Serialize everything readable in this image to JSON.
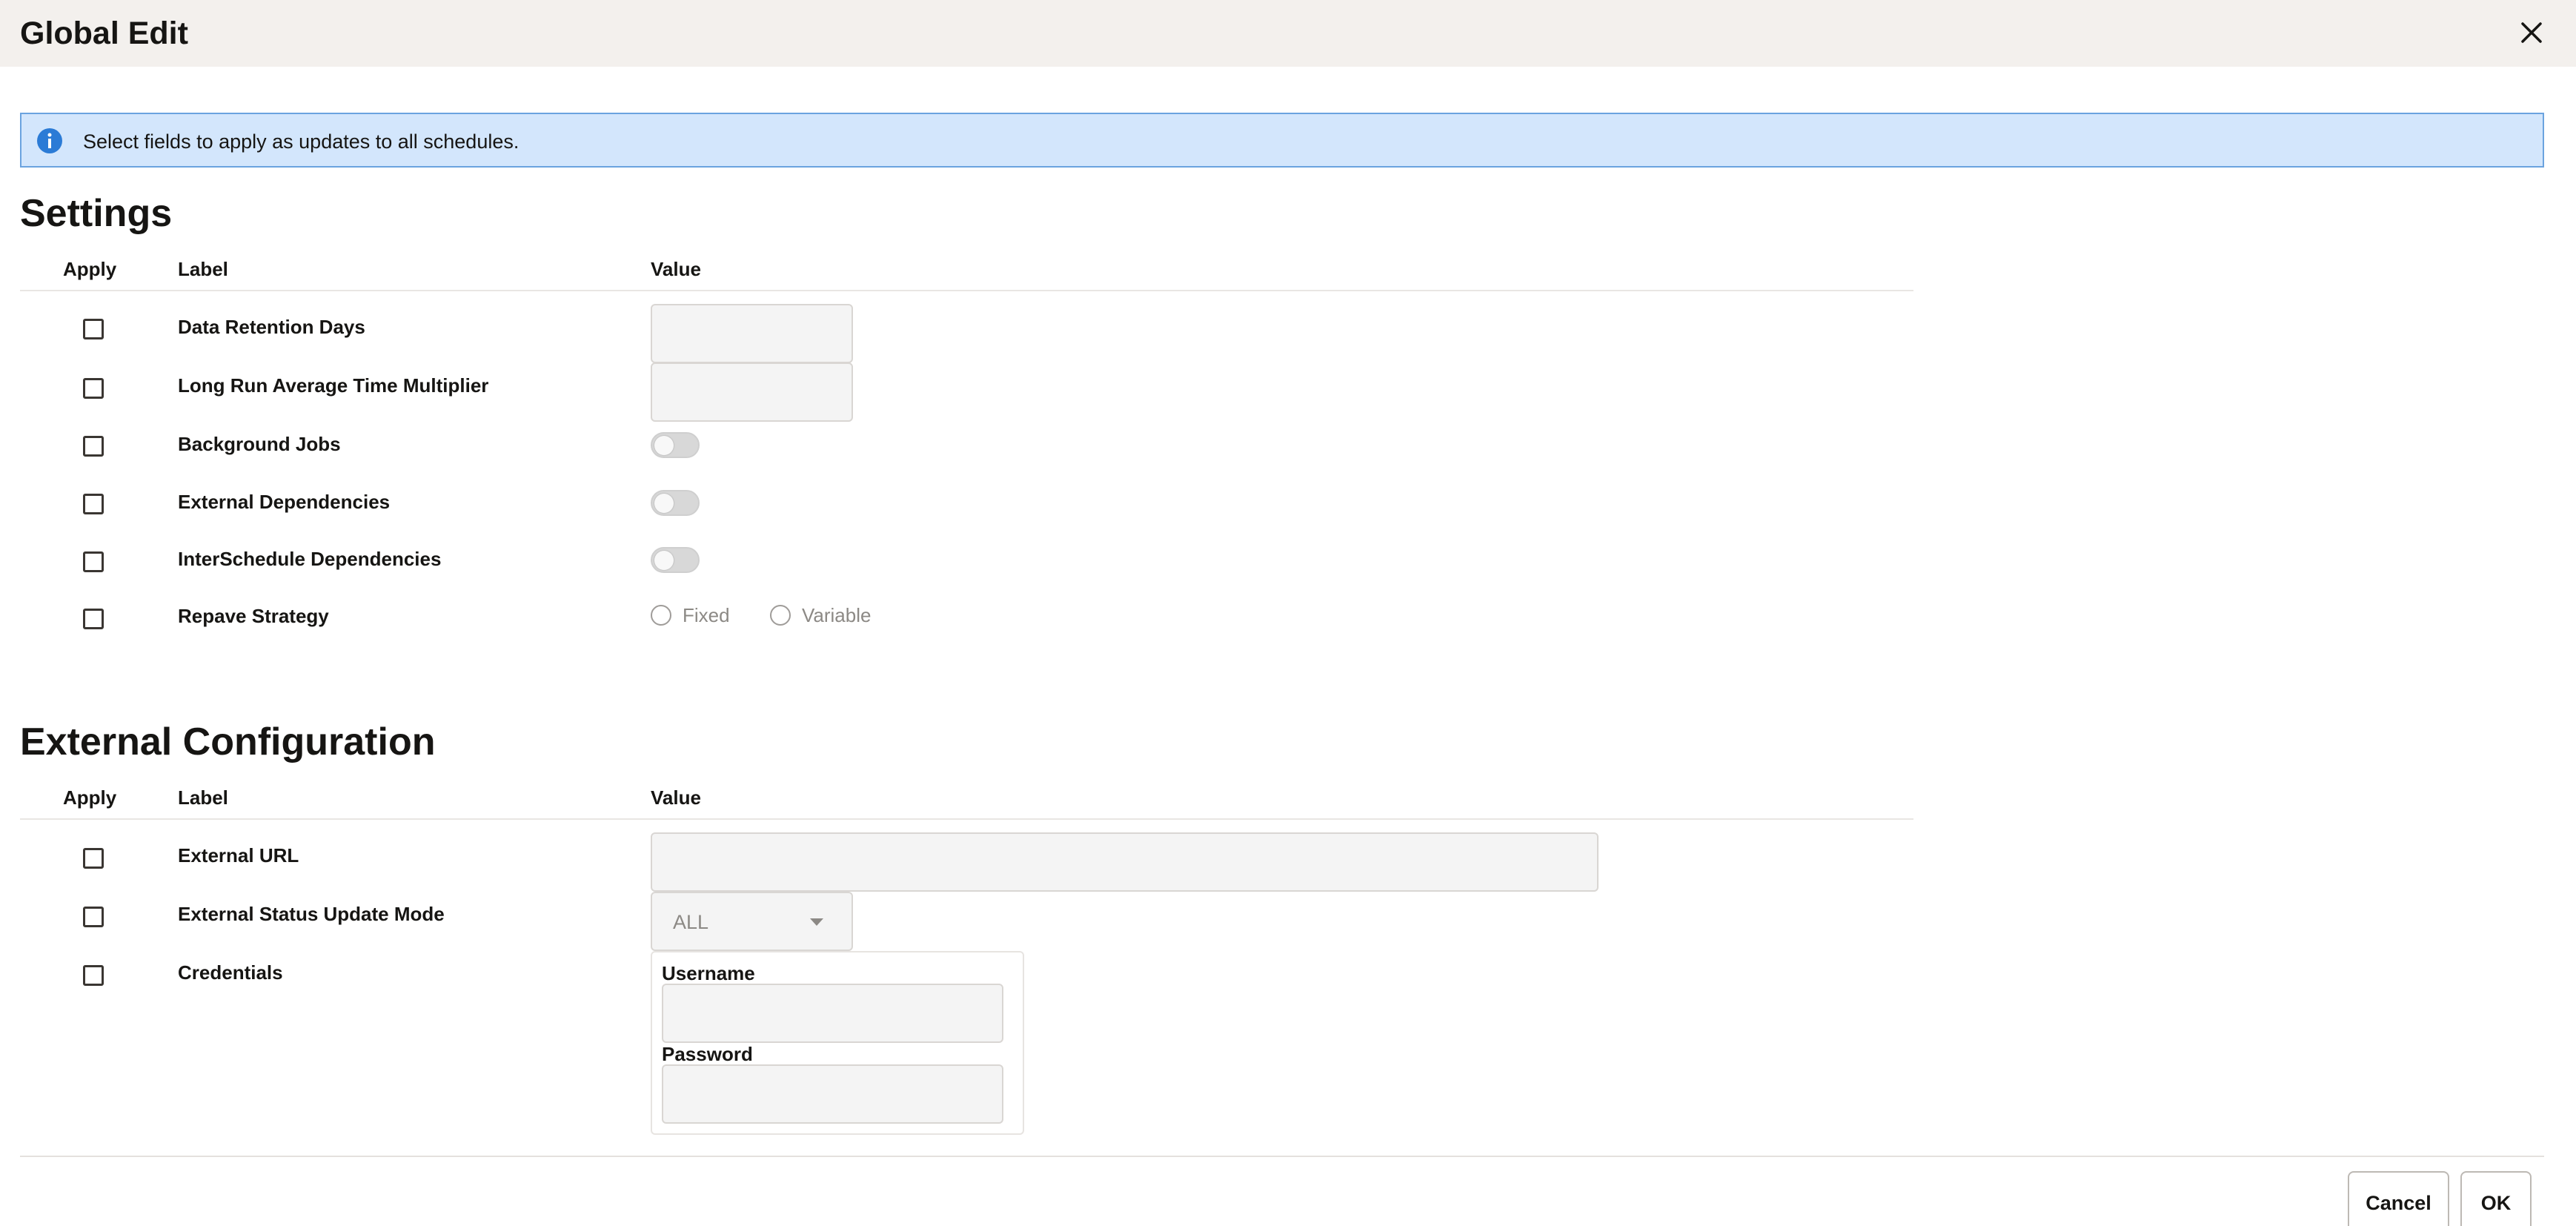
{
  "dialog": {
    "title": "Global Edit"
  },
  "banner": {
    "text": "Select fields to apply as updates to all schedules.",
    "color": "#d3e6fc"
  },
  "settings": {
    "title": "Settings",
    "headers": {
      "apply": "Apply",
      "label": "Label",
      "value": "Value"
    },
    "rows": [
      {
        "label": "Data Retention Days",
        "type": "text",
        "value": ""
      },
      {
        "label": "Long Run Average Time Multiplier",
        "type": "text",
        "value": ""
      },
      {
        "label": "Background Jobs",
        "type": "toggle",
        "value": "off"
      },
      {
        "label": "External Dependencies",
        "type": "toggle",
        "value": "off"
      },
      {
        "label": "InterSchedule Dependencies",
        "type": "toggle",
        "value": "off"
      },
      {
        "label": "Repave Strategy",
        "type": "radio",
        "options": [
          "Fixed",
          "Variable"
        ]
      }
    ]
  },
  "external": {
    "title": "External Configuration",
    "headers": {
      "apply": "Apply",
      "label": "Label",
      "value": "Value"
    },
    "rows": [
      {
        "label": "External URL",
        "type": "text",
        "value": ""
      },
      {
        "label": "External Status Update Mode",
        "type": "select",
        "value": "ALL"
      },
      {
        "label": "Credentials",
        "type": "credentials",
        "username_label": "Username",
        "password_label": "Password"
      }
    ]
  },
  "footer": {
    "cancel_label": "Cancel",
    "ok_label": "OK"
  }
}
